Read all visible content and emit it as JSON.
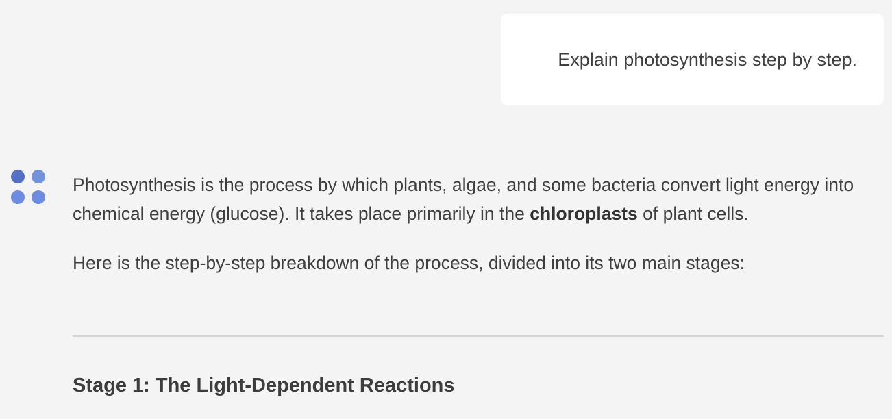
{
  "user_message": {
    "text": "Explain photosynthesis step by step."
  },
  "assistant": {
    "avatar_colors": [
      "#5470c6",
      "#7292dd",
      "#6b8ce0",
      "#6b8ce0"
    ],
    "paragraph1": {
      "before": "Photosynthesis is the process by which plants, algae, and some bacteria convert light energy into chemical energy (glucose). It takes place primarily in the ",
      "bold": "chloroplasts",
      "after": " of plant cells."
    },
    "paragraph2": "Here is the step-by-step breakdown of the process, divided into its two main stages:",
    "stage1_heading": "Stage 1: The Light-Dependent Reactions"
  }
}
